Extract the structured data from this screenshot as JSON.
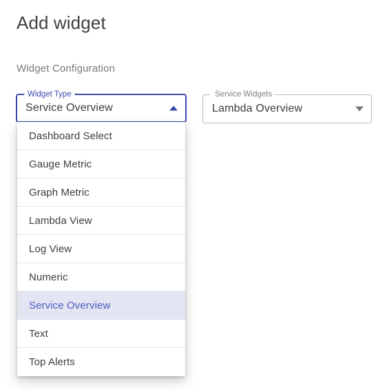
{
  "page": {
    "title": "Add widget",
    "section_title": "Widget Configuration"
  },
  "fields": {
    "widget_type": {
      "label": "Widget Type",
      "value": "Service Overview",
      "arrow_icon": "chevron-up-icon",
      "state": "focused-open",
      "accent_color": "#3949ab"
    },
    "service_widgets": {
      "label": "Service Widgets",
      "value": "Lambda Overview",
      "arrow_icon": "chevron-down-icon",
      "state": "collapsed",
      "border_color": "#b9b9b9"
    }
  },
  "widget_type_menu": {
    "selected": "Service Overview",
    "highlight_bg": "#e3e5f3",
    "highlight_text": "#4d5bbe",
    "options": [
      {
        "label": "Dashboard Select"
      },
      {
        "label": "Gauge Metric"
      },
      {
        "label": "Graph Metric"
      },
      {
        "label": "Lambda View"
      },
      {
        "label": "Log View"
      },
      {
        "label": "Numeric"
      },
      {
        "label": "Service Overview"
      },
      {
        "label": "Text"
      },
      {
        "label": "Top Alerts"
      }
    ]
  }
}
